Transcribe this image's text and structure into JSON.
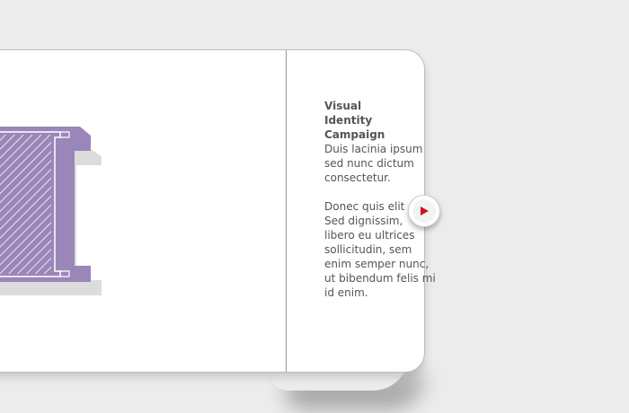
{
  "panel": {
    "title": "Visual Identity Campaign",
    "paragraph1": "Duis lacinia ipsum sed nunc dictum consectetur.",
    "paragraph2": "Donec quis elit est. Sed dignissim, libero eu ultrices sollicitudin, sem enim semper nunc, ut bibendum felis mi id enim."
  },
  "icons": {
    "next": "play-arrow-icon"
  },
  "colors": {
    "background": "#ececed",
    "card": "#ffffff",
    "accent_purple": "#9a86b8",
    "play_red": "#d0121c",
    "text": "#555555"
  }
}
